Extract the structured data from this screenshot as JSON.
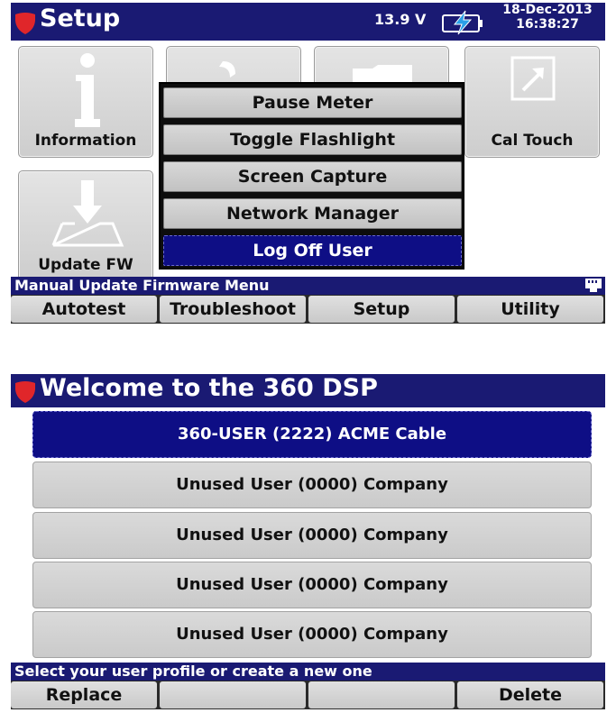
{
  "setup_screen": {
    "title": "Setup",
    "voltage": "13.9 V",
    "date": "18-Dec-2013",
    "time": "16:38:27",
    "tiles": {
      "information": "Information",
      "cal_touch": "Cal Touch",
      "update_fw": "Update FW"
    },
    "popup_menu": [
      {
        "label": "Pause Meter",
        "selected": false
      },
      {
        "label": "Toggle Flashlight",
        "selected": false
      },
      {
        "label": "Screen Capture",
        "selected": false
      },
      {
        "label": "Network Manager",
        "selected": false
      },
      {
        "label": "Log Off User",
        "selected": true
      }
    ],
    "status_text": "Manual Update Firmware Menu",
    "softkeys": [
      "Autotest",
      "Troubleshoot",
      "Setup",
      "Utility"
    ]
  },
  "welcome_screen": {
    "title": "Welcome to the 360 DSP",
    "profiles": [
      {
        "label": "360-USER (2222) ACME Cable",
        "selected": true
      },
      {
        "label": "Unused User (0000) Company",
        "selected": false
      },
      {
        "label": "Unused User (0000) Company",
        "selected": false
      },
      {
        "label": "Unused User (0000) Company",
        "selected": false
      },
      {
        "label": "Unused User (0000) Company",
        "selected": false
      }
    ],
    "status_text": "Select your user profile or create a new one",
    "softkeys": [
      "Replace",
      "",
      "",
      "Delete"
    ]
  },
  "colors": {
    "title_bar": "#1a1a73",
    "selected": "#0e0e85",
    "shield": "#e0262a",
    "tile": "#d6d6d6"
  },
  "icons": [
    "shield-icon",
    "battery-charging-icon",
    "info-icon",
    "calibrate-arrow-icon",
    "download-tray-icon",
    "network-port-icon"
  ]
}
